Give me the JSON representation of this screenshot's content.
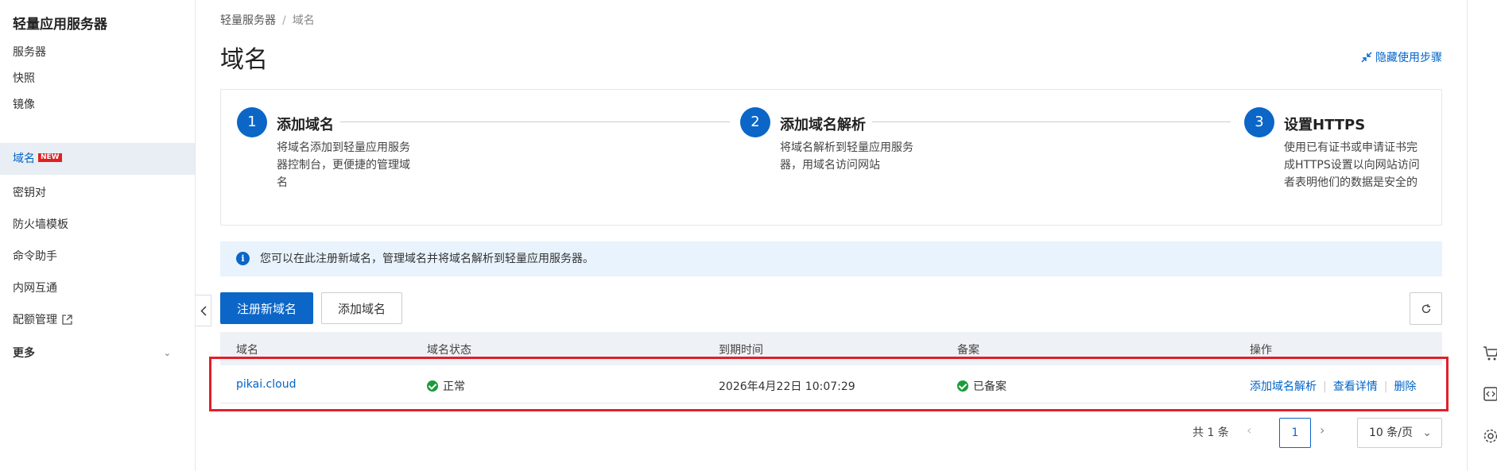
{
  "sidebar": {
    "title": "轻量应用服务器",
    "items": [
      {
        "label": "服务器"
      },
      {
        "label": "快照"
      },
      {
        "label": "镜像"
      },
      {
        "label": "域名",
        "badge": "NEW"
      },
      {
        "label": "密钥对"
      },
      {
        "label": "防火墙模板"
      },
      {
        "label": "命令助手"
      },
      {
        "label": "内网互通"
      },
      {
        "label": "配额管理"
      },
      {
        "label": "更多"
      }
    ]
  },
  "breadcrumb": {
    "root": "轻量服务器",
    "sep": "/",
    "current": "域名"
  },
  "page": {
    "title": "域名",
    "hide_steps": "隐藏使用步骤"
  },
  "steps": [
    {
      "num": "1",
      "title": "添加域名",
      "desc": "将域名添加到轻量应用服务器控制台，更便捷的管理域名"
    },
    {
      "num": "2",
      "title": "添加域名解析",
      "desc": "将域名解析到轻量应用服务器，用域名访问网站"
    },
    {
      "num": "3",
      "title": "设置HTTPS",
      "desc": "使用已有证书或申请证书完成HTTPS设置以向网站访问者表明他们的数据是安全的"
    }
  ],
  "info": {
    "text": "您可以在此注册新域名，管理域名并将域名解析到轻量应用服务器。",
    "icon": "i"
  },
  "toolbar": {
    "register_label": "注册新域名",
    "add_label": "添加域名"
  },
  "table": {
    "headers": [
      "域名",
      "域名状态",
      "到期时间",
      "备案",
      "操作"
    ],
    "rows": [
      {
        "domain": "pikai.cloud",
        "status": "正常",
        "expire": "2026年4月22日 10:07:29",
        "icp": "已备案",
        "ops": [
          "添加域名解析",
          "查看详情",
          "删除"
        ]
      }
    ]
  },
  "pagination": {
    "total": "共 1 条",
    "page": "1",
    "page_size": "10 条/页",
    "prev": "‹",
    "next": "›"
  },
  "colors": {
    "accent": "#0b66c8",
    "success": "#1a9c3a",
    "highlight": "#e0202a"
  }
}
